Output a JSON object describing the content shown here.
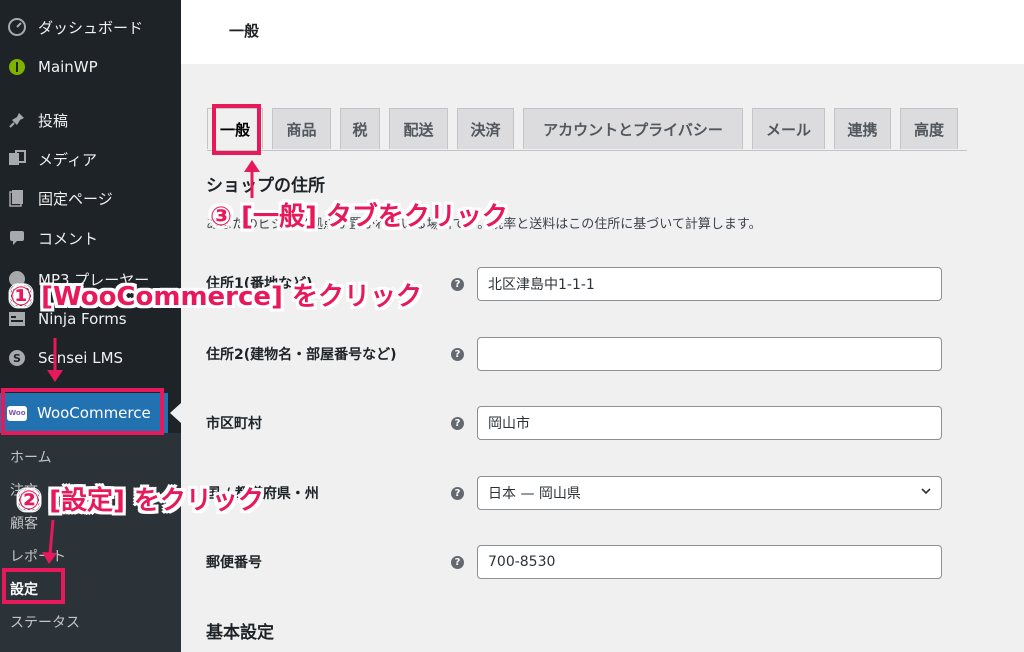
{
  "sidebar": {
    "items": [
      {
        "label": "ダッシュボード",
        "icon": "dashboard-icon"
      },
      {
        "label": "MainWP",
        "icon": "mainwp-icon"
      },
      {
        "label": "投稿",
        "icon": "pin-icon"
      },
      {
        "label": "メディア",
        "icon": "media-icon"
      },
      {
        "label": "固定ページ",
        "icon": "page-icon"
      },
      {
        "label": "コメント",
        "icon": "comment-icon"
      },
      {
        "label": "MP3 プレーヤー",
        "icon": "music-icon"
      },
      {
        "label": "Ninja Forms",
        "icon": "forms-icon"
      },
      {
        "label": "Sensei LMS",
        "icon": "sensei-icon"
      }
    ],
    "woocommerce": {
      "label": "WooCommerce",
      "logo": "Woo"
    },
    "submenu": [
      "ホーム",
      "注文",
      "顧客",
      "レポート",
      "設定",
      "ステータス"
    ]
  },
  "header": {
    "title": "一般"
  },
  "tabs": [
    "一般",
    "商品",
    "税",
    "配送",
    "決済",
    "アカウントとプライバシー",
    "メール",
    "連携",
    "高度"
  ],
  "section": {
    "title": "ショップの住所",
    "description": "あなたのビジネス拠点が置かれている場所です。税率と送料はこの住所に基づいて計算します。",
    "fields": [
      {
        "label": "住所1(番地など)",
        "value": "北区津島中1-1-1"
      },
      {
        "label": "住所2(建物名・部屋番号など)",
        "value": ""
      },
      {
        "label": "市区町村",
        "value": "岡山市"
      },
      {
        "label": "国 / 都道府県・州",
        "value": "日本 — 岡山県"
      },
      {
        "label": "郵便番号",
        "value": "700-8530"
      }
    ],
    "next_title": "基本設定"
  },
  "annotations": {
    "step1": "① [WooCommerce] をクリック",
    "step2": "② [設定] をクリック",
    "step3": "③ [一般] タブをクリック"
  },
  "colors": {
    "accent": "#e8195a",
    "sidebar": "#1d2327",
    "wp_blue": "#2271b1"
  }
}
